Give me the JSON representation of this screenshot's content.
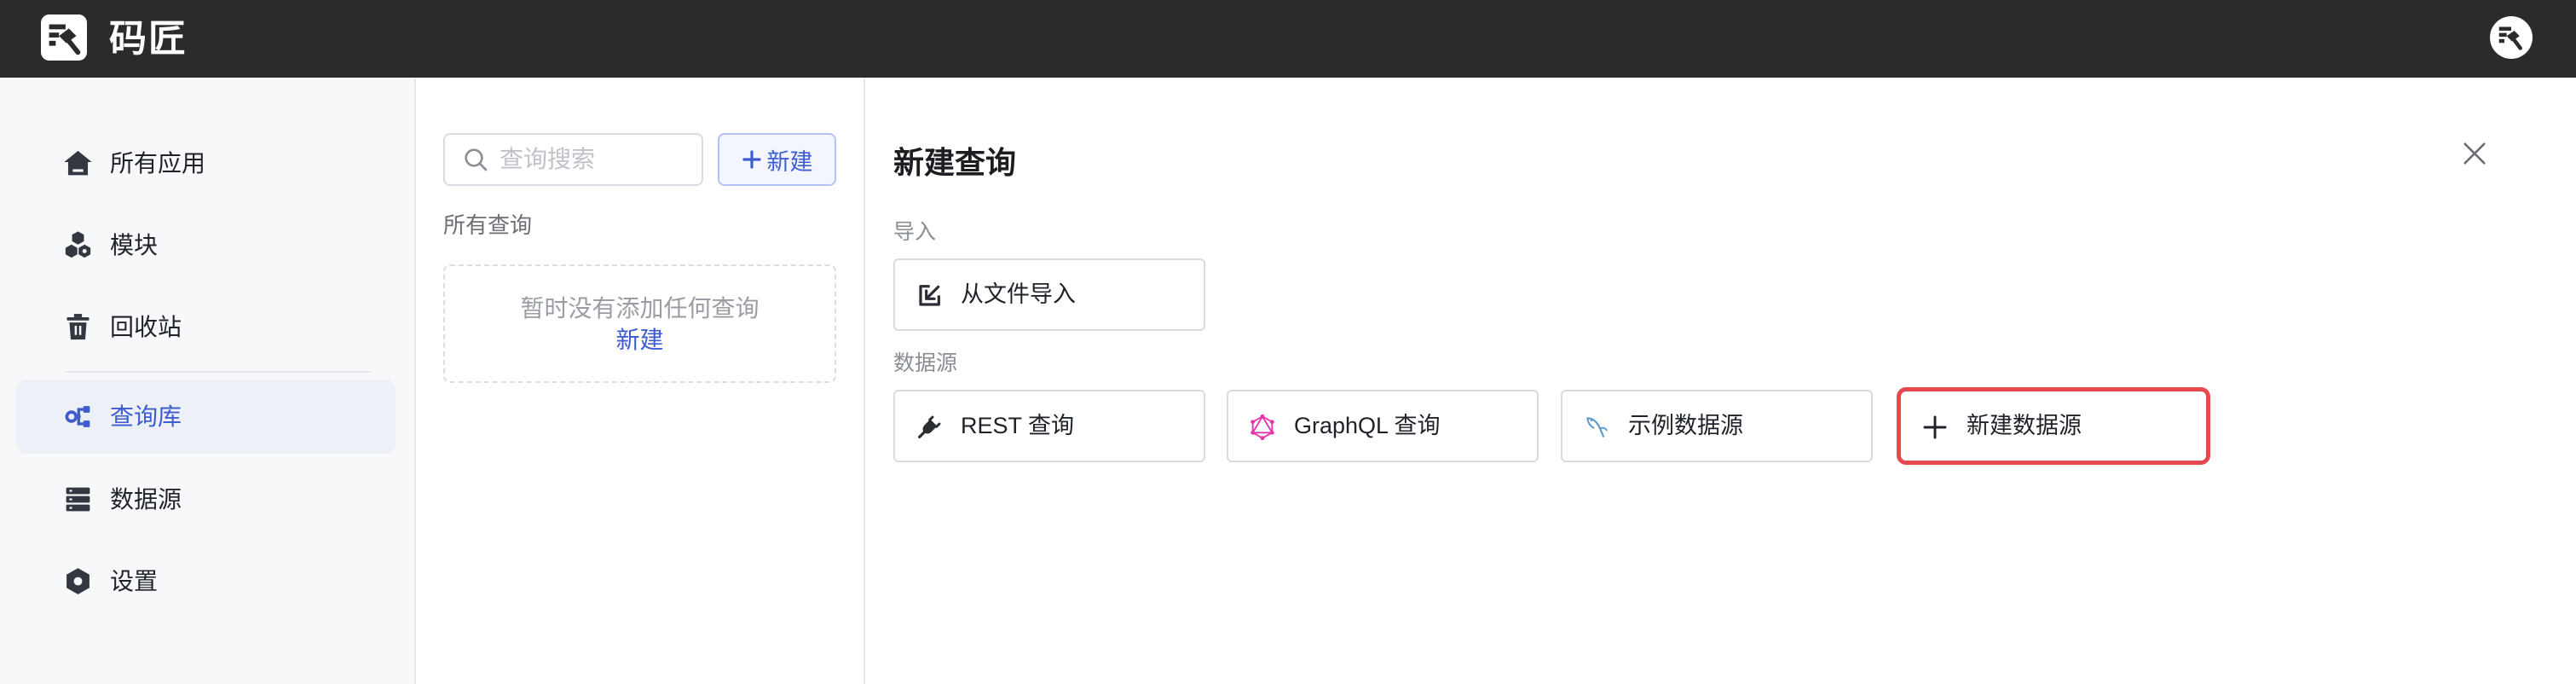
{
  "app": {
    "title": "码匠",
    "logo_icon": "hammer-logo-icon",
    "avatar_icon": "user-avatar-icon"
  },
  "colors": {
    "topbar": "#2b2b2b",
    "accent": "#3c5ccf",
    "highlight": "#e5484d",
    "graphql": "#e535ab",
    "sample_datasource": "#5b9ac6"
  },
  "sidebar": {
    "items": [
      {
        "label": "所有应用",
        "icon": "home-icon",
        "active": false
      },
      {
        "label": "模块",
        "icon": "modules-icon",
        "active": false
      },
      {
        "label": "回收站",
        "icon": "trash-icon",
        "active": false
      },
      {
        "label": "查询库",
        "icon": "query-library-icon",
        "active": true
      },
      {
        "label": "数据源",
        "icon": "database-icon",
        "active": false
      },
      {
        "label": "设置",
        "icon": "settings-icon",
        "active": false
      }
    ]
  },
  "query_panel": {
    "search_placeholder": "查询搜索",
    "search_value": "",
    "new_button_label": "新建",
    "section_label": "所有查询",
    "empty_text": "暂时没有添加任何查询",
    "empty_link": "新建"
  },
  "new_query": {
    "title": "新建查询",
    "import_section_label": "导入",
    "import_button": {
      "label": "从文件导入",
      "icon": "import-file-icon"
    },
    "datasource_section_label": "数据源",
    "datasources": [
      {
        "label": "REST 查询",
        "icon": "rest-plug-icon",
        "highlighted": false
      },
      {
        "label": "GraphQL 查询",
        "icon": "graphql-icon",
        "highlighted": false
      },
      {
        "label": "示例数据源",
        "icon": "mysql-dolphin-icon",
        "highlighted": false
      },
      {
        "label": "新建数据源",
        "icon": "plus-icon",
        "highlighted": true
      }
    ]
  }
}
